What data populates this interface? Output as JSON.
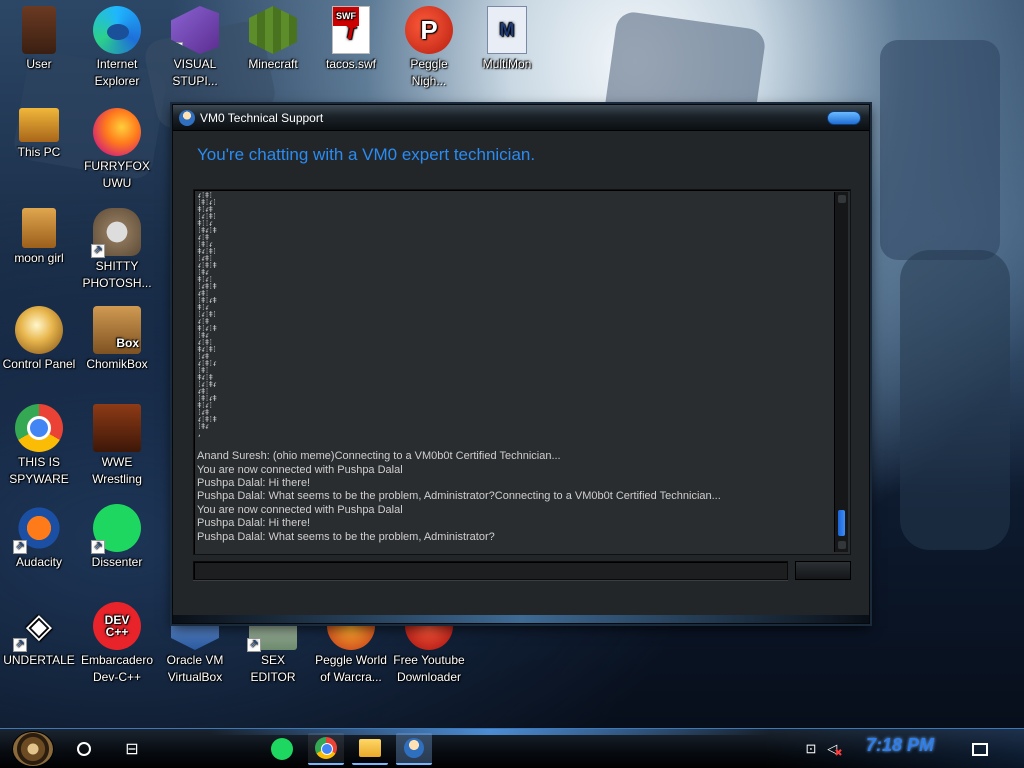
{
  "desktop": {
    "icons": [
      {
        "label": "User",
        "icon": "user-folder-icon"
      },
      {
        "label": "Internet\nExplorer",
        "icon": "edge-browser-icon"
      },
      {
        "label": "VISUAL\nSTUPI...",
        "icon": "visual-studio-icon"
      },
      {
        "label": "Minecraft",
        "icon": "minecraft-icon"
      },
      {
        "label": "tacos.swf",
        "icon": "flash-swf-icon"
      },
      {
        "label": "Peggle\nNigh...",
        "icon": "peggle-icon"
      },
      {
        "label": "MultiMon",
        "icon": "multimon-icon"
      },
      {
        "label": "This PC",
        "icon": "computer-icon"
      },
      {
        "label": "FURRYFOX\nUWU",
        "icon": "firefox-icon"
      },
      {
        "label": "moon girl",
        "icon": "folder-icon"
      },
      {
        "label": "SHITTY\nPHOTOSH...",
        "icon": "gimp-icon"
      },
      {
        "label": "Control Panel",
        "icon": "control-panel-icon"
      },
      {
        "label": "ChomikBox",
        "icon": "chomikbox-icon"
      },
      {
        "label": "THIS IS\nSPYWARE",
        "icon": "chrome-icon"
      },
      {
        "label": "WWE\nWrestling",
        "icon": "wwe-icon"
      },
      {
        "label": "Audacity",
        "icon": "audacity-icon"
      },
      {
        "label": "Dissenter",
        "icon": "dissenter-icon"
      },
      {
        "label": "UNDERTALE",
        "icon": "unity-icon"
      },
      {
        "label": "Embarcadero\nDev-C++",
        "icon": "devcpp-icon"
      },
      {
        "label": "Oracle VM\nVirtualBox",
        "icon": "virtualbox-icon"
      },
      {
        "label": "SEX\nEDITOR",
        "icon": "editor-icon"
      },
      {
        "label": "Peggle World\nof Warcra...",
        "icon": "peggle-icon"
      },
      {
        "label": "Free Youtube\nDownloader",
        "icon": "youtube-downloader-icon"
      }
    ]
  },
  "window": {
    "title": "VM0 Technical Support",
    "heading": "You're chatting with a VM0 expert technician.",
    "glitch_text": "ᵳ⁞ǂ⁞\n⁞ǂ⁞ᵳ⁞\nǂ⁞ᵳǂ\n⁞ᵳ⁞ǂ⁞\nǂ⁞⁞ᵳ\n⁞ǂᵳ⁞ǂ\nᵳ⁞ǂ\n⁞ǂ⁞ᵳ\nǂᵳ⁞ǂ⁞\n⁞ᵳǂ⁞\nᵳ⁞ǂ⁞ǂ\n⁞ǂᵳ\nǂ⁞ᵳ⁞\n⁞ᵳǂ⁞ǂ\nᵳǂ⁞\n⁞ǂ⁞ᵳǂ\nǂ⁞ᵳ\n⁞ᵳ⁞ǂ⁞\nᵳ⁞ǂ\nǂ⁞ᵳ⁞ǂ\n⁞ǂᵳ\nᵳ⁞ǂ⁞\nǂᵳ⁞ǂ⁞\n⁞ᵳǂ\nᵳ⁞ǂ⁞ᵳ\n⁞ǂ⁞\nǂᵳ⁞ǂ\n⁞ᵳ⁞ǂᵳ\nᵳǂ⁞\n⁞ǂ⁞ᵳǂ\nǂ⁞ᵳ⁞\n⁞ᵳǂ\nᵳ⁞ǂ⁞ǂ\n⁞ǂᵳ\n,",
    "messages": [
      "Anand Suresh: (ohio meme)Connecting to a VM0b0t Certified Technician...",
      "You are now connected with Pushpa Dalal",
      "Pushpa Dalal: Hi there!",
      "Pushpa Dalal: What seems to be the problem, Administrator?Connecting to a VM0b0t Certified Technician...",
      "You are now connected with Pushpa Dalal",
      "Pushpa Dalal: Hi there!",
      "Pushpa Dalal: What seems to be the problem, Administrator?"
    ],
    "input_value": "",
    "send_label": ""
  },
  "taskbar": {
    "pinned": [
      {
        "name": "spotify",
        "icon": "spotify-icon"
      },
      {
        "name": "chrome",
        "icon": "chrome-icon"
      },
      {
        "name": "file-explorer",
        "icon": "folder-icon"
      },
      {
        "name": "vm0-technical-support",
        "icon": "support-agent-icon"
      }
    ],
    "clock": "7:18 PM"
  }
}
